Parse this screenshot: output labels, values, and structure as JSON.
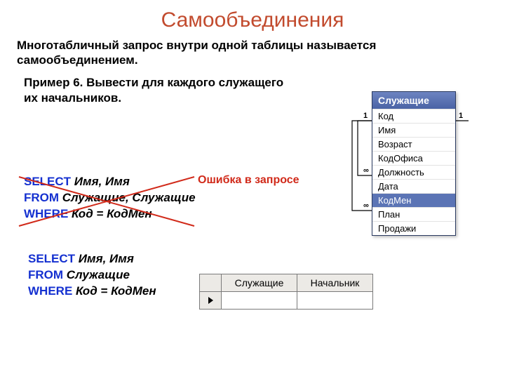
{
  "title": "Самообъединения",
  "intro": "Многотабличный запрос внутри одной таблицы называется самообъединением.",
  "example_label": "Пример 6. Вывести для каждого служащего их начальников.",
  "error_label": "Ошибка в запросе",
  "sql1": {
    "kw_select": "SELECT",
    "select_list": " Имя, Имя",
    "kw_from": "FROM",
    "from_list": " Служащие, Служащие",
    "kw_where": "WHERE",
    "where_cond": " Код = КодМен"
  },
  "sql2": {
    "kw_select": "SELECT",
    "select_list": " Имя, Имя",
    "kw_from": "FROM",
    "from_list": " Служащие",
    "kw_where": "WHERE",
    "where_cond": " Код = КодМен"
  },
  "result_grid": {
    "headers": [
      "Служащие",
      "Начальник"
    ]
  },
  "table_diagram": {
    "header": "Служащие",
    "fields": [
      "Код",
      "Имя",
      "Возраст",
      "КодОфиса",
      "Должность",
      "Дата",
      "КодМен",
      "План",
      "Продажи"
    ],
    "selected_field": "КодМен",
    "left_card_1": "1",
    "left_card_inf1": "∞",
    "left_card_inf2": "∞",
    "right_card_1": "1"
  }
}
